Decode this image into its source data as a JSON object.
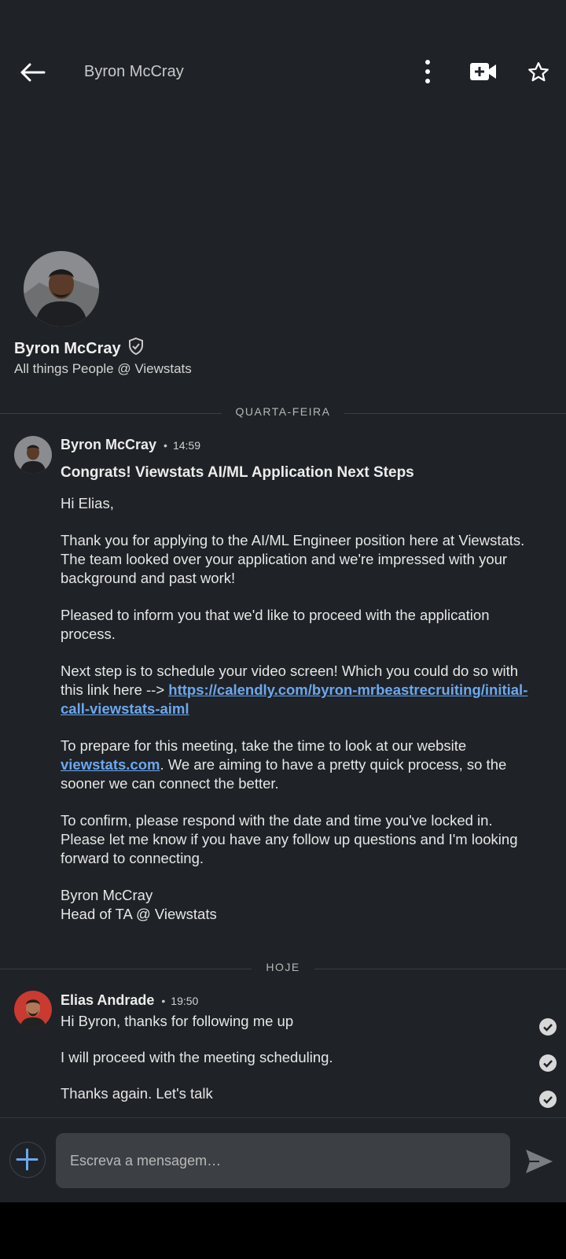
{
  "header": {
    "title": "Byron McCray",
    "icons": {
      "back": "back-arrow-icon",
      "more": "more-vertical-icon",
      "video": "video-add-icon",
      "star": "star-icon"
    }
  },
  "profile": {
    "name": "Byron McCray",
    "headline": "All things People @ Viewstats",
    "badge_icon": "verified-shield-icon"
  },
  "dividers": {
    "first": "QUARTA-FEIRA",
    "second": "HOJE"
  },
  "message": {
    "sender": "Byron McCray",
    "dot": "•",
    "time": "14:59",
    "subject": "Congrats! Viewstats AI/ML Application Next Steps",
    "greeting": "Hi Elias,",
    "para1": "Thank you for applying to the AI/ML Engineer position here at Viewstats. The team looked over your application and we're impressed with your background and past work!",
    "para2": "Pleased to inform you that we'd like to proceed with the application process.",
    "para3_prefix": "Next step is to schedule your video screen! Which you could do so with this link here --> ",
    "para3_link": "https://calendly.com/byron-mrbeastrecruiting/initial-call-viewstats-aiml",
    "para4_prefix": "To prepare for this meeting, take the time to look at our website ",
    "para4_link": "viewstats.com",
    "para4_suffix": ". We are aiming to have a pretty quick process, so the sooner we can connect the better.",
    "para5": "To confirm, please respond with the date and time you've locked in. Please let me know if you have any follow up questions and I'm looking forward to connecting.",
    "sign_name": "Byron McCray",
    "sign_title": "Head of TA @ Viewstats"
  },
  "reply": {
    "sender": "Elias Andrade",
    "dot": "•",
    "time": "19:50",
    "lines": [
      "Hi Byron, thanks for following me up",
      "I will proceed with the meeting scheduling.",
      "Thanks again. Let's talk"
    ]
  },
  "composer": {
    "placeholder": "Escreva a mensagem…",
    "add_icon": "plus-icon",
    "send_icon": "send-icon"
  },
  "colors": {
    "background": "#1f2226",
    "link": "#6aa8f0",
    "input": "#3c3f43"
  }
}
